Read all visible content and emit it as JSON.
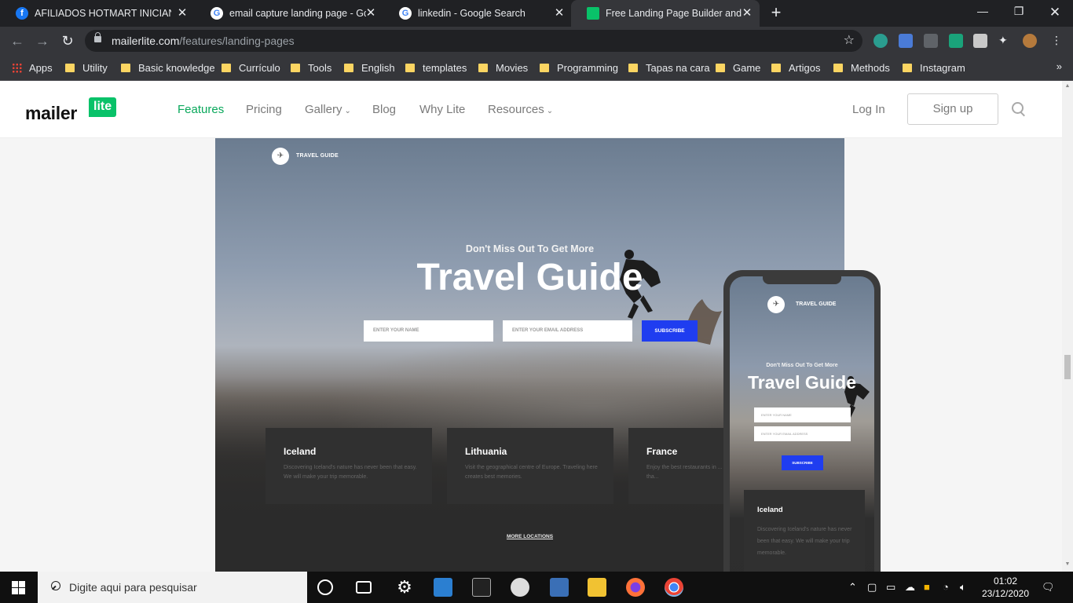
{
  "browser": {
    "tabs": [
      {
        "title": "AFILIADOS HOTMART INICIANTES",
        "favicon": "facebook-icon"
      },
      {
        "title": "email capture landing page - Google Search",
        "favicon": "google-icon"
      },
      {
        "title": "linkedin - Google Search",
        "favicon": "google-icon"
      },
      {
        "title": "Free Landing Page Builder and Templates",
        "favicon": "mailerlite-icon"
      }
    ],
    "new_tab": "+",
    "url_host": "mailerlite.com",
    "url_path": "/features/landing-pages",
    "bookmarks": [
      "Apps",
      "Utility",
      "Basic knowledge",
      "Currículo",
      "Tools",
      "English",
      "templates",
      "Movies",
      "Programming",
      "Tapas na cara",
      "Game",
      "Artigos",
      "Methods",
      "Instagram"
    ],
    "bookmarks_more": "»"
  },
  "site": {
    "logo_mailer": "mailer",
    "logo_lite": "lite",
    "nav": [
      "Features",
      "Pricing",
      "Gallery",
      "Blog",
      "Why Lite",
      "Resources"
    ],
    "login": "Log In",
    "signup": "Sign up"
  },
  "preview": {
    "brand": "TRAVEL GUIDE",
    "kicker": "Don't Miss Out To Get More",
    "title": "Travel Guide",
    "name_placeholder": "ENTER YOUR NAME",
    "email_placeholder": "ENTER YOUR EMAIL ADDRESS",
    "subscribe": "SUBSCRIBE",
    "cards": [
      {
        "title": "Iceland",
        "desc": "Discovering Iceland's nature has never been that easy. We will make your trip memorable."
      },
      {
        "title": "Lithuania",
        "desc": "Visit the geographical centre of Europe. Traveling here creates best memories."
      },
      {
        "title": "France",
        "desc": "Enjoy the best restaurants in ... guarantee, you will love tha..."
      }
    ],
    "more": "MORE LOCATIONS"
  },
  "phone": {
    "brand": "TRAVEL GUIDE",
    "kicker": "Don't Miss Out To Get More",
    "title": "Travel Guide",
    "name_placeholder": "ENTER YOUR NAME",
    "email_placeholder": "ENTER YOUR EMAIL ADDRESS",
    "subscribe": "SUBSCRIBE",
    "card_title": "Iceland",
    "card_desc": "Discovering Iceland's nature has never been that easy. We will make your trip memorable."
  },
  "taskbar": {
    "search_placeholder": "Digite aqui para pesquisar",
    "time": "01:02",
    "date": "23/12/2020"
  },
  "colors": {
    "brand_green": "#09c269",
    "subscribe_blue": "#1f3df0"
  }
}
